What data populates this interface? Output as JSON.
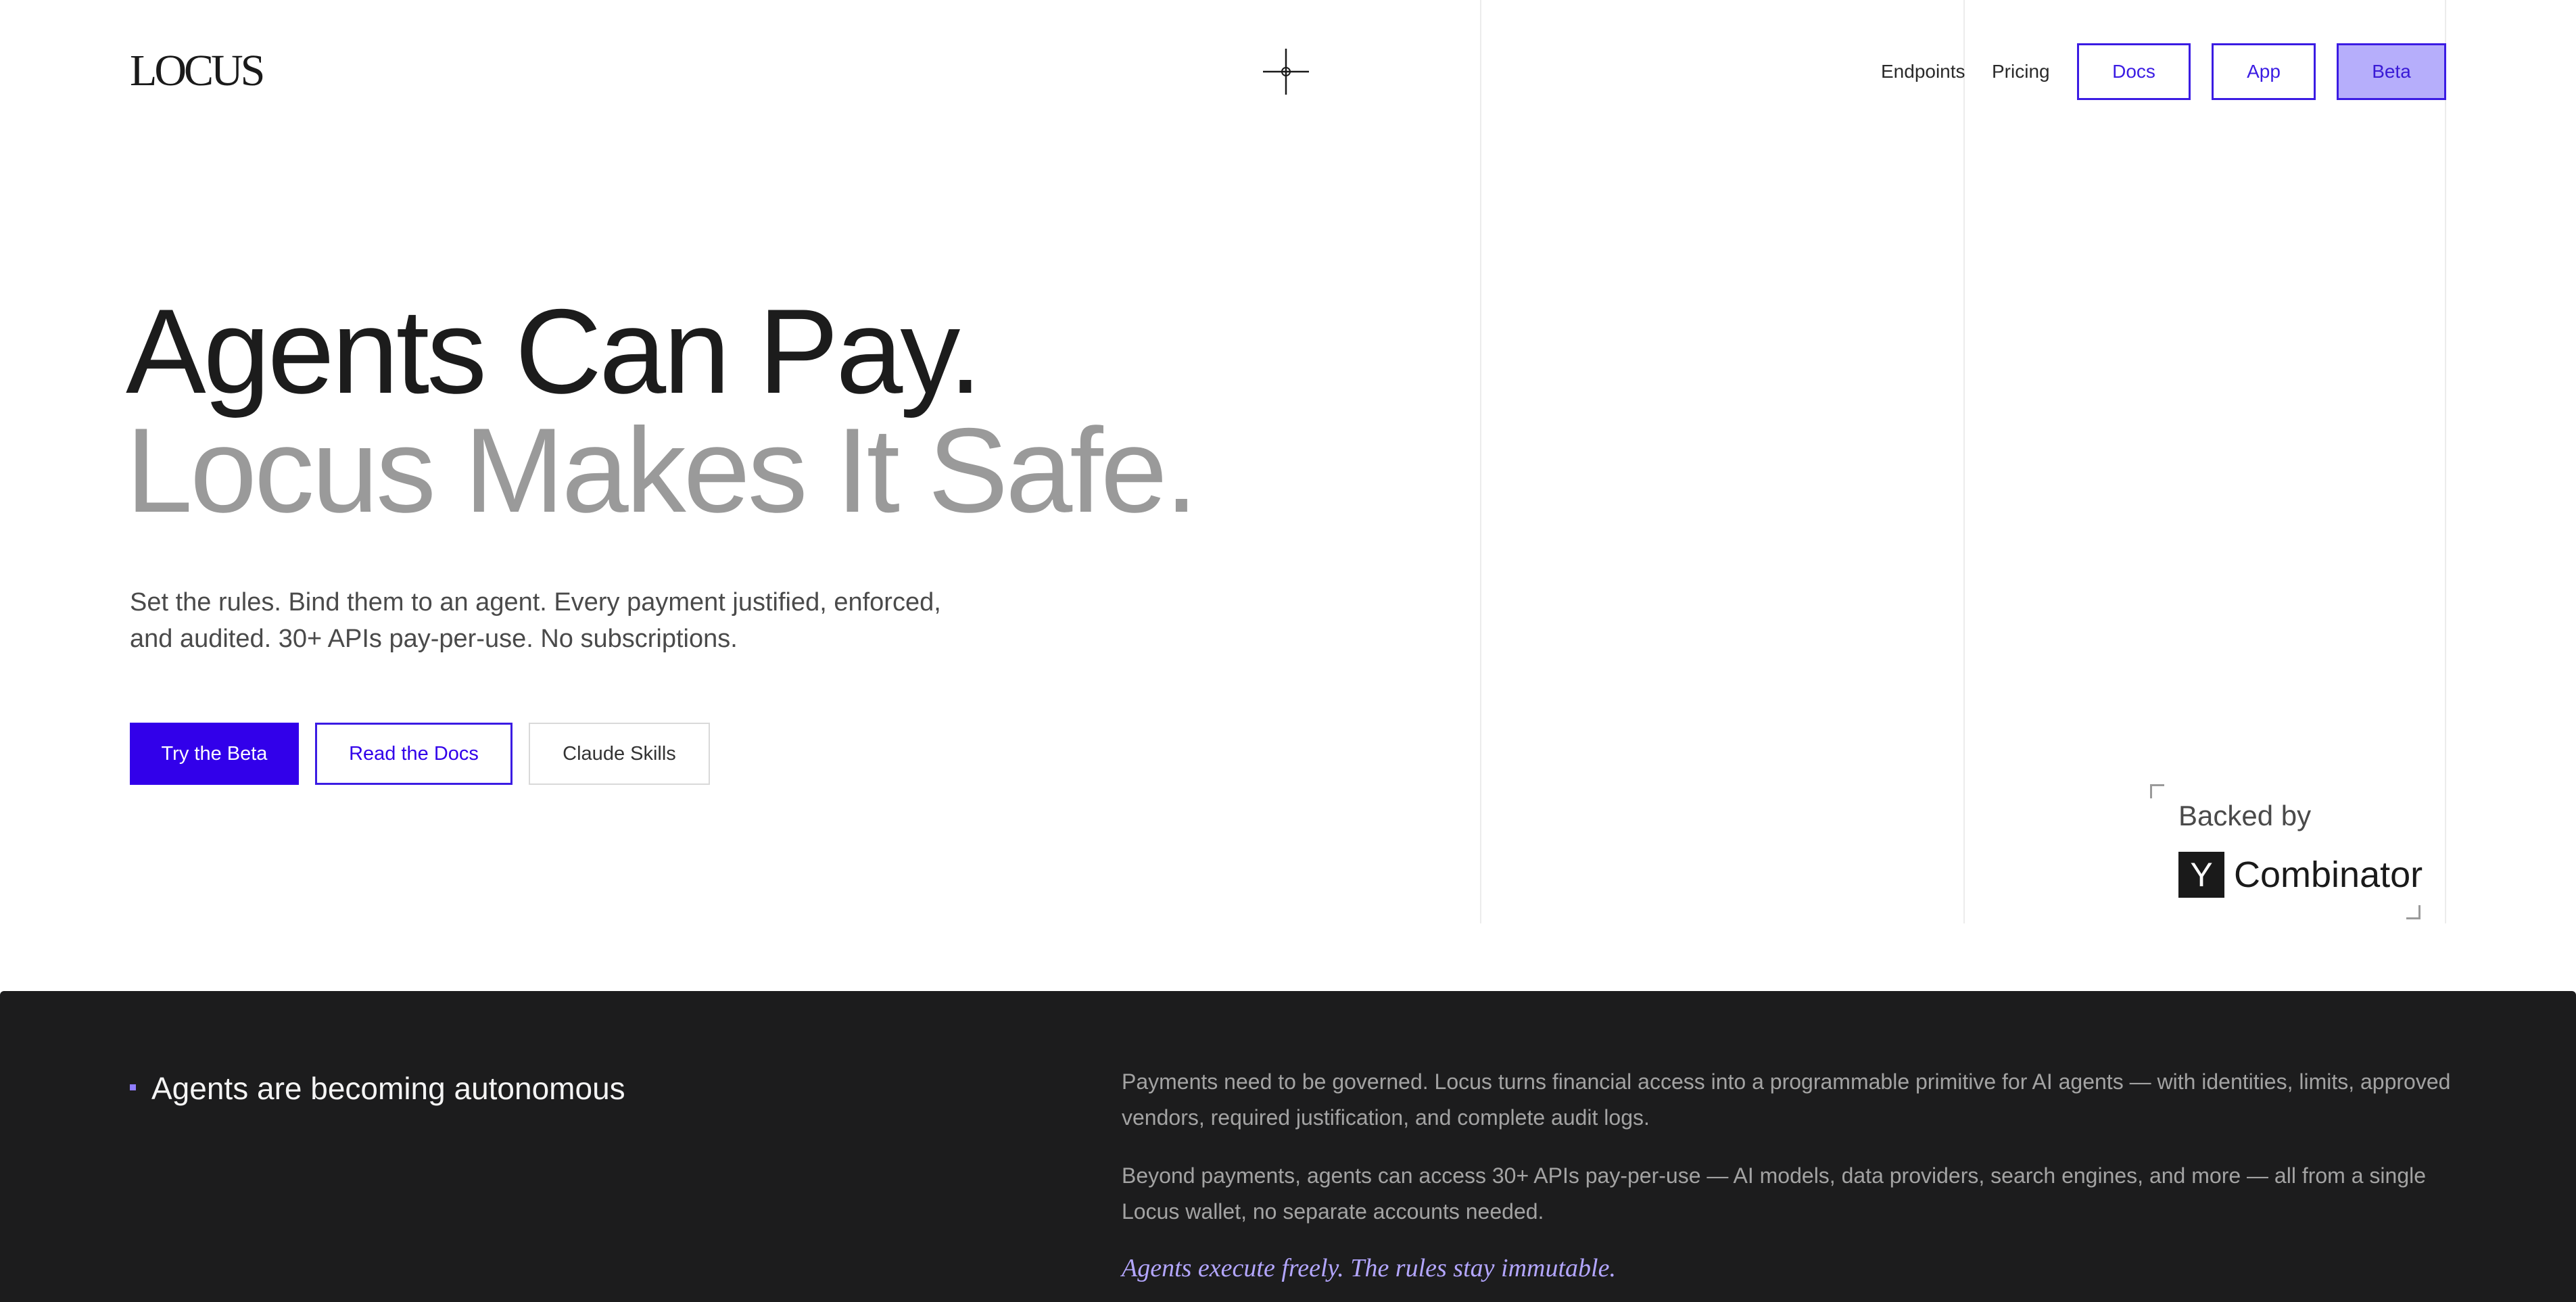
{
  "header": {
    "logo": "LOCUS",
    "nav": {
      "endpoints": "Endpoints",
      "pricing": "Pricing",
      "docs": "Docs",
      "app": "App",
      "beta": "Beta"
    }
  },
  "hero": {
    "headline_line1": "Agents Can Pay.",
    "headline_line2": "Locus Makes It Safe.",
    "subtitle": "Set the rules. Bind them to an agent. Every payment justified, enforced, and audited. 30+ APIs pay-per-use. No subscriptions.",
    "cta_primary": "Try the Beta",
    "cta_docs": "Read the Docs",
    "cta_skills": "Claude Skills"
  },
  "backer": {
    "label": "Backed by",
    "logo_letter": "Y",
    "name": "Combinator"
  },
  "section": {
    "title": "Agents are becoming autonomous",
    "para1": "Payments need to be governed. Locus turns financial access into a programmable primitive for AI agents — with identities, limits, approved vendors, required justification, and complete audit logs.",
    "para2": "Beyond payments, agents can access 30+ APIs pay-per-use — AI models, data providers, search engines, and more — all from a single Locus wallet, no separate accounts needed.",
    "tagline": "Agents execute freely. The rules stay immutable."
  },
  "colors": {
    "accent": "#3200ea",
    "accent_light": "#b6aefb",
    "dark_bg": "#1c1c1d",
    "tagline": "#b3a6ff"
  },
  "icons": {
    "center_mark": "four-point-star-icon",
    "bullet": "square-bullet-icon"
  }
}
